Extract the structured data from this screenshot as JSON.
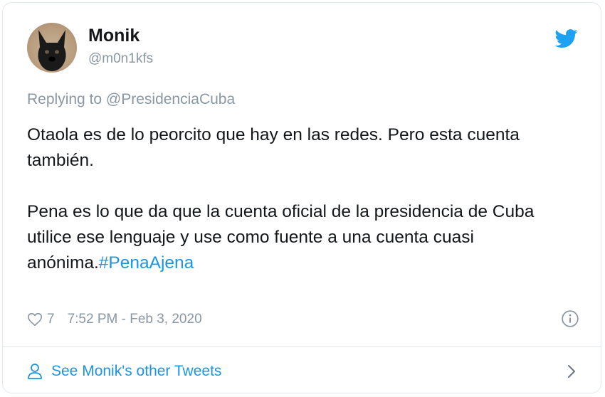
{
  "author": {
    "name": "Monik",
    "handle": "@m0n1kfs"
  },
  "reply": {
    "prefix": "Replying to ",
    "mention": "@PresidenciaCuba"
  },
  "tweet": {
    "paragraph1": "Otaola es de lo peorcito que hay en las redes. Pero esta cuenta también.",
    "paragraph2": "Pena es lo que da que la cuenta oficial de la presidencia de Cuba utilice ese lenguaje y use como fuente a una cuenta cuasi anónima.",
    "hashtag": "#PenaAjena"
  },
  "meta": {
    "likes": "7",
    "timestamp": "7:52 PM - Feb 3, 2020"
  },
  "footer": {
    "see_more": "See Monik's other Tweets"
  },
  "icons": {
    "brand": "twitter-bird-icon",
    "like": "heart-icon",
    "info": "info-icon",
    "person": "person-icon",
    "chevron": "chevron-right-icon"
  },
  "colors": {
    "brand": "#1da1f2",
    "link": "#1b95e0",
    "muted": "#8a97a3",
    "text": "#14171a",
    "border": "#e1e8ed"
  }
}
